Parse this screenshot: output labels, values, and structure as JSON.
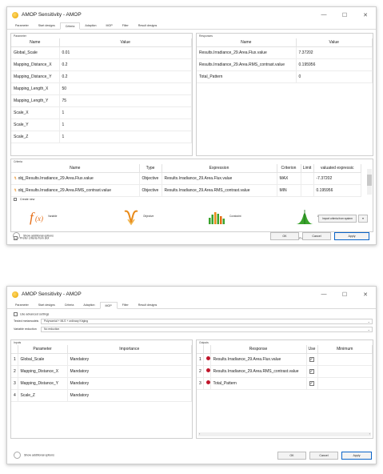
{
  "window1": {
    "title": "AMOP Sensitivity - AMOP",
    "tabs": [
      "Parameter",
      "Start designs",
      "Criteria",
      "Adaption",
      "MOP",
      "Filter",
      "Result designs"
    ],
    "active_tab": "Criteria",
    "parameter_panel": {
      "label": "Parameter",
      "columns": [
        "Name",
        "Value"
      ],
      "rows": [
        [
          "Global_Scale",
          "0.01"
        ],
        [
          "Mapping_Distance_X",
          "0.2"
        ],
        [
          "Mapping_Distance_Y",
          "0.2"
        ],
        [
          "Mapping_Length_X",
          "50"
        ],
        [
          "Mapping_Length_Y",
          "75"
        ],
        [
          "Scale_X",
          "1"
        ],
        [
          "Scale_Y",
          "1"
        ],
        [
          "Scale_Z",
          "1"
        ]
      ]
    },
    "responses_panel": {
      "label": "Responses",
      "columns": [
        "Name",
        "Value"
      ],
      "rows": [
        [
          "Results.Irradiance_29.Area.Flux.value",
          "7.37202"
        ],
        [
          "Results.Irradiance_29.Area.RMS_contrast.value",
          "0.195956"
        ],
        [
          "Total_Pattern",
          "0"
        ]
      ]
    },
    "criteria_panel": {
      "label": "Criteria",
      "columns": [
        "Name",
        "Type",
        "Expression",
        "Criterion",
        "Limit",
        "valuated expressic"
      ],
      "rows": [
        [
          "obj_Results.Irradiance_29.Area.Flux.value",
          "Objective",
          "Results.Irradiance_29.Area.Flux.value",
          "MAX",
          "",
          "-7.37202"
        ],
        [
          "obj_Results.Irradiance_29.Area.RMS_contrast.value",
          "Objective",
          "Results.Irradiance_29.Area.RMS_contrast.value",
          "MIN",
          "",
          "0.195956"
        ]
      ],
      "create_new_label": "Create new",
      "types": [
        "Variable",
        "Objective",
        "Constraint",
        "Limit state"
      ]
    },
    "prefer_label": "Prefer criteria from slot",
    "instant_label": "Instant visualization",
    "import_label": "Import criteria from system",
    "additional_label": "Show additional options",
    "ok": "OK",
    "cancel": "Cancel",
    "apply": "Apply"
  },
  "window2": {
    "title": "AMOP Sensitivity - AMOP",
    "tabs": [
      "Parameter",
      "Start designs",
      "Criteria",
      "Adaption",
      "MOP",
      "Filter",
      "Result designs"
    ],
    "active_tab": "MOP",
    "advanced_label": "Use advanced settings",
    "metamodel_label": "Tested metamodels",
    "metamodel_value": "Polynomial + MLS + ordinary Kriging",
    "reduction_label": "Variable reduction",
    "reduction_value": "No reduction",
    "inputs_panel": {
      "label": "Inputs",
      "columns": [
        "Parameter",
        "Importance"
      ],
      "rows": [
        [
          "1",
          "Global_Scale",
          "Mandatory"
        ],
        [
          "2",
          "Mapping_Distance_X",
          "Mandatory"
        ],
        [
          "3",
          "Mapping_Distance_Y",
          "Mandatory"
        ],
        [
          "4",
          "Scale_Z",
          "Mandatory"
        ]
      ]
    },
    "outputs_panel": {
      "label": "Outputs",
      "columns": [
        "Response",
        "Use",
        "Minimum"
      ],
      "rows": [
        [
          "1",
          "Results.Irradiance_29.Area.Flux.value"
        ],
        [
          "2",
          "Results.Irradiance_29.Area.RMS_contrast.value"
        ],
        [
          "3",
          "Total_Pattern"
        ]
      ]
    },
    "additional_label": "Show additional options",
    "ok": "OK",
    "cancel": "Cancel",
    "apply": "Apply"
  },
  "colors": {
    "accent": "#0a64c8",
    "status_red": "#c0152a",
    "objective_orange": "#e98a18",
    "variable_orange": "#e56b12",
    "constraint_green": "#3aa32c"
  }
}
